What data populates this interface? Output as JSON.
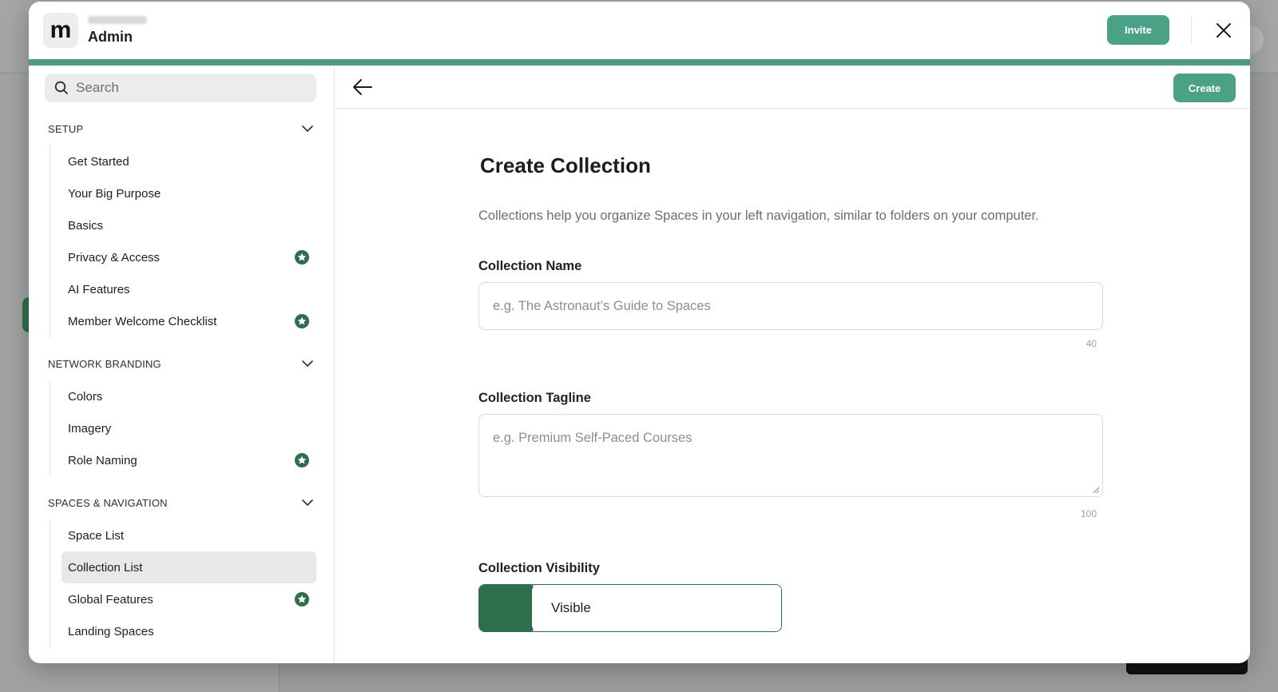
{
  "colors": {
    "accent": "#4ba185",
    "brand_dark": "#2f6e4a",
    "star_badge": "#2f6e4a"
  },
  "header": {
    "logo_letter": "m",
    "title": "Admin",
    "invite_label": "Invite",
    "close_icon": "close-icon"
  },
  "sidebar": {
    "search_placeholder": "Search",
    "sections": [
      {
        "title": "SETUP",
        "items": [
          {
            "label": "Get Started",
            "badge": false
          },
          {
            "label": "Your Big Purpose",
            "badge": false
          },
          {
            "label": "Basics",
            "badge": false
          },
          {
            "label": "Privacy & Access",
            "badge": true
          },
          {
            "label": "AI Features",
            "badge": false
          },
          {
            "label": "Member Welcome Checklist",
            "badge": true
          }
        ]
      },
      {
        "title": "NETWORK BRANDING",
        "items": [
          {
            "label": "Colors",
            "badge": false
          },
          {
            "label": "Imagery",
            "badge": false
          },
          {
            "label": "Role Naming",
            "badge": true
          }
        ]
      },
      {
        "title": "SPACES & NAVIGATION",
        "items": [
          {
            "label": "Space List",
            "badge": false
          },
          {
            "label": "Collection List",
            "badge": false,
            "active": true
          },
          {
            "label": "Global Features",
            "badge": true
          },
          {
            "label": "Landing Spaces",
            "badge": false
          }
        ]
      }
    ]
  },
  "toolbar": {
    "back_icon": "arrow-left-icon",
    "create_label": "Create"
  },
  "form": {
    "title": "Create Collection",
    "description": "Collections help you organize Spaces in your left navigation, similar to folders on your computer.",
    "name_label": "Collection Name",
    "name_placeholder": "e.g. The Astronaut’s Guide to Spaces",
    "name_max": "40",
    "tagline_label": "Collection Tagline",
    "tagline_placeholder": "e.g. Premium Self-Paced Courses",
    "tagline_max": "100",
    "visibility_label": "Collection Visibility",
    "visibility_value": "Visible"
  }
}
